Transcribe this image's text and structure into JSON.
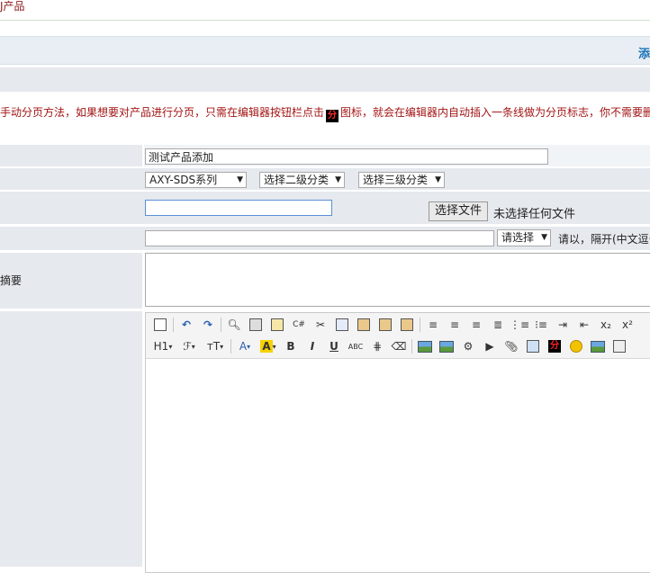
{
  "breadcrumb": "J产品",
  "header_link": "添",
  "notice": {
    "before": "手动分页方法，如果想要对产品进行分页，只需在编辑器按钮栏点击",
    "icon_text": "分",
    "after": "图标，就会在编辑器内自动插入一条线做为分页标志，你不需要删"
  },
  "form": {
    "name_value": "测试产品添加",
    "category1": "AXY-SDS系列",
    "category2": "选择二级分类",
    "category3": "选择三级分类",
    "image_value": "",
    "file_button": "选择文件",
    "file_status": "未选择任何文件",
    "tags_value": "",
    "tags_select": "请选择",
    "tags_hint": "请以，隔开(中文逗号",
    "summary_label": "摘要"
  },
  "toolbar": {
    "row1": [
      "source-icon",
      "undo-icon",
      "redo-icon",
      "preview-icon",
      "print-icon",
      "template-icon",
      "code-icon",
      "cut-icon",
      "copy-icon",
      "paste-icon",
      "paste-text-icon",
      "paste-word-icon",
      "align-left-icon",
      "align-center-icon",
      "align-right-icon",
      "justify-icon",
      "ordered-list-icon",
      "unordered-list-icon",
      "indent-icon",
      "outdent-icon",
      "subscript-icon",
      "superscript-icon"
    ],
    "row2": {
      "heading": "H1",
      "font": "ℱ",
      "size": "тT",
      "font_color": "A",
      "highlight": "A",
      "bold": "B",
      "italic": "I",
      "underline": "U",
      "strike": "ABC",
      "page_break": "分"
    }
  }
}
